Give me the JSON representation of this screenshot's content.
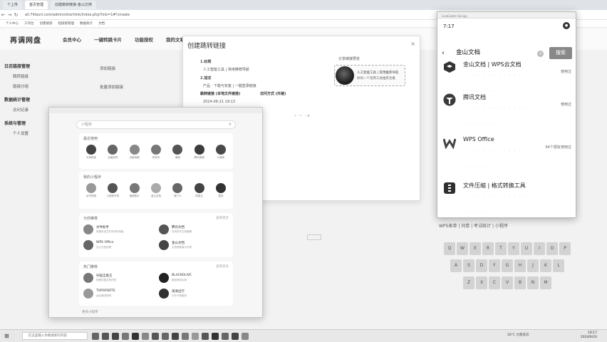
{
  "browser": {
    "tabs": [
      "个上传",
      "首页管理",
      "创建跳转链接-金山文档"
    ],
    "url": "all.7liteurl.com/admin/shortlink/index.php?link=1#!/create",
    "bookmarks": [
      "个人中心",
      "工作台",
      "创建链接",
      "短链接管理",
      "数据统计",
      "文档"
    ]
  },
  "site": {
    "logo": "再调网盘",
    "nav": [
      "会员中心",
      "一键转跳卡片",
      "功能授权",
      "我的文章链接"
    ],
    "sidebar": [
      {
        "section": "日志链接管理",
        "items": [
          "跳转链接",
          "链接分组"
        ]
      },
      {
        "section": "数据统计管理",
        "items": [
          "访问记录"
        ]
      },
      {
        "section": "系统与管理",
        "items": [
          "个人设置"
        ]
      }
    ],
    "mid_labels": [
      "添加链接",
      "批量添加链接"
    ]
  },
  "dialog": {
    "title": "创建跳转链接",
    "close": "×",
    "link_title_label": "1.标题",
    "link_title_value": "人工智能工具 | 常用推荐导航",
    "link_desc_label": "2.描述",
    "link_desc_value": "产品 · 下载与安装 | 一键登录链接",
    "link_type_label": "跳转链接 (本地文件链接)",
    "link_mode_label": "访问方式 (外链)",
    "date": "2024-06-21 19:13",
    "preview_title": "分享链接预览",
    "preview_line1": "人工智能工具 | 常用推荐导航",
    "preview_line2": "你的一个常用工具推荐合集"
  },
  "panel": {
    "search_placeholder": "小程序",
    "cards": [
      {
        "title": "最近使用",
        "more": "",
        "icons": [
          "头条精选",
          "百度贴吧",
          "百度地图",
          "拼多多",
          "美团",
          "腾讯视频",
          "小程序"
        ]
      },
      {
        "title": "我的小程序",
        "more": "",
        "icons": [
          "京东购物",
          "小程序开发",
          "相册助手",
          "金山文档",
          "饿了么",
          "网易云",
          "更多"
        ]
      },
      {
        "title": "为你推荐",
        "more": "查看更多",
        "list": [
          {
            "t1": "文件助手",
            "t2": "快速发送文件到手机电脑"
          },
          {
            "t1": "腾讯文档",
            "t2": "在线协作文档编辑"
          },
          {
            "t1": "WPS Office",
            "t2": "办公文档处理"
          },
          {
            "t1": "金山文档",
            "t2": "文档表格演示共享"
          }
        ]
      },
      {
        "title": "热门推荐",
        "more": "查看更多",
        "list": [
          {
            "t1": "扫描全能王",
            "t2": "拍照扫描文档识别"
          },
          {
            "t1": "BLACKOLIVE",
            "t2": "精品咖啡点单"
          },
          {
            "t1": "TOPSPORTS",
            "t2": "运动潮流购物"
          },
          {
            "t1": "滴滴出行",
            "t2": "打车代驾服务"
          }
        ]
      }
    ],
    "footer": "更多小程序"
  },
  "phone": {
    "window_title": "LiveCaster Scrcpy",
    "time": "7:17",
    "query": "金山文档",
    "search_button": "搜索",
    "results": [
      {
        "name": "金山文档 | WPS云文档",
        "meta": "使用过",
        "icon": "cube-icon",
        "color": "#333333"
      },
      {
        "name": "腾讯文档",
        "meta": "使用过",
        "icon": "docs-icon",
        "color": "#3a3a3a"
      },
      {
        "name": "WPS Office",
        "meta": "64个朋友使用过",
        "icon": "wps-icon",
        "color": "#444444"
      },
      {
        "name": "文件压缩 | 格式转换工具",
        "meta": "",
        "icon": "zip-icon",
        "color": "#2f2f2f"
      }
    ]
  },
  "keyboard": {
    "head": "WPS表单 | 问卷 | 考试统计 | 小程序",
    "rows": [
      [
        "Q",
        "W",
        "E",
        "R",
        "T",
        "Y",
        "U",
        "I",
        "O",
        "P"
      ],
      [
        "A",
        "S",
        "D",
        "F",
        "G",
        "H",
        "J",
        "K",
        "L"
      ],
      [
        "Z",
        "X",
        "C",
        "V",
        "B",
        "N",
        "M"
      ]
    ]
  },
  "taskbar": {
    "search": "在这里输入你要搜索的内容",
    "weather": "28°C 大部多云",
    "time": "19:17",
    "date": "2024/6/24"
  }
}
